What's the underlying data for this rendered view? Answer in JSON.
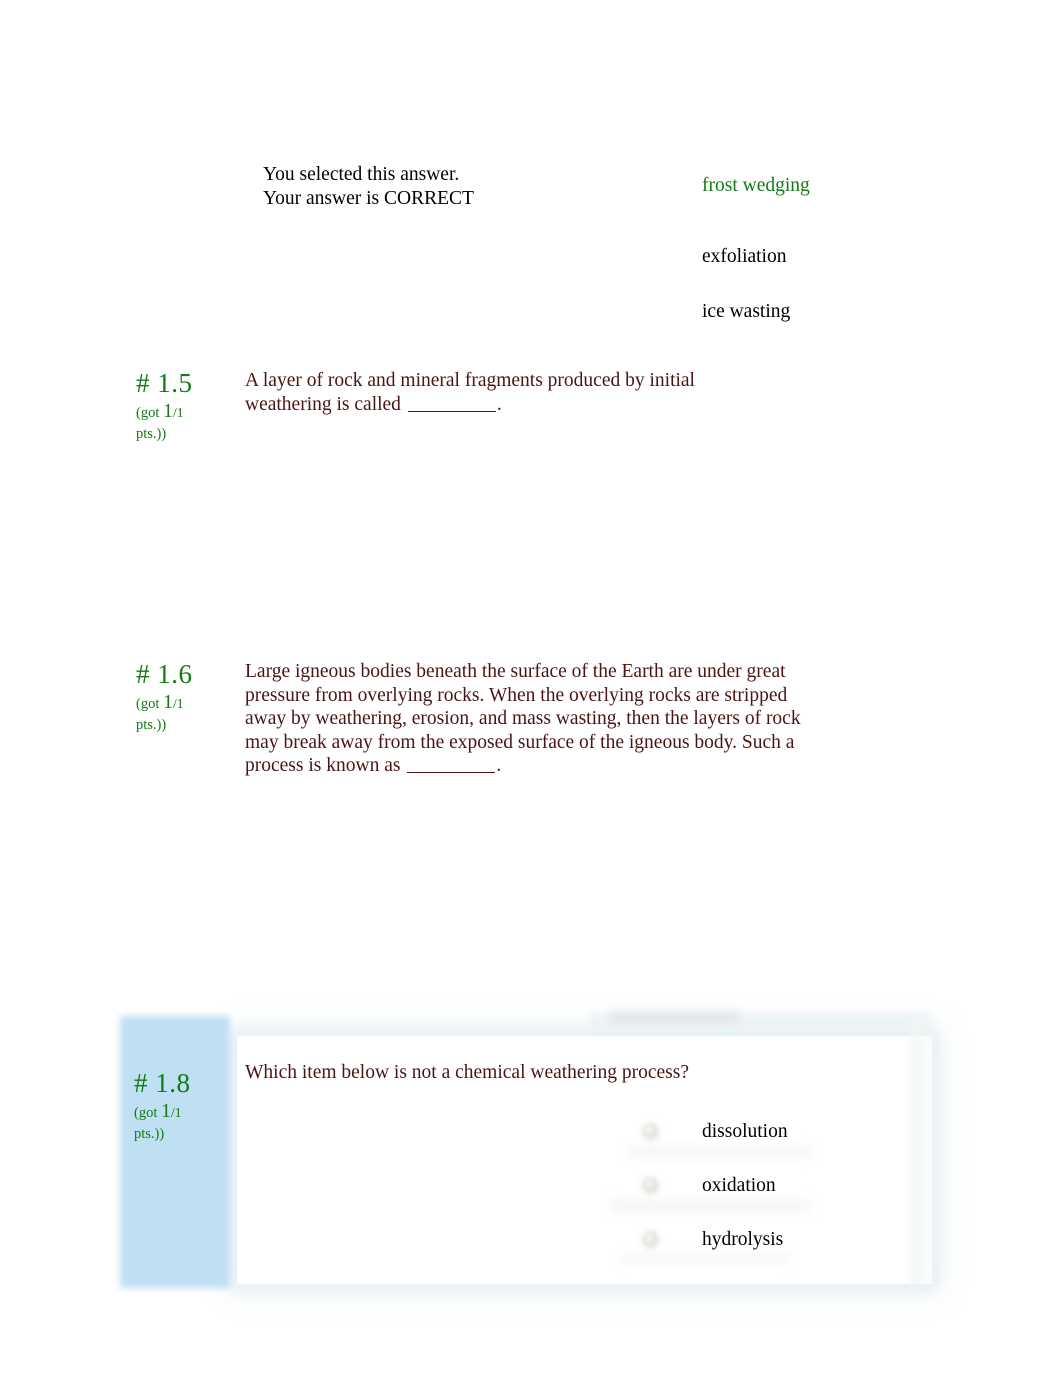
{
  "page": {
    "background_color": "#ffffff",
    "question_text_color": "#4a1414",
    "score_color": "#137a13",
    "selected_answer_color": "#137a13",
    "highlight_panel_color": "#bfdff3"
  },
  "previous_question_feedback": {
    "line1": "You selected this answer.",
    "line2": "Your answer is CORRECT",
    "options": [
      {
        "label": "frost wedging",
        "selected": true
      },
      {
        "label": "exfoliation",
        "selected": false
      },
      {
        "label": "ice wasting",
        "selected": false
      }
    ]
  },
  "questions": [
    {
      "number": "# 1.5",
      "points_prefix": "(got",
      "points_earned": "1",
      "points_possible": "/1",
      "points_suffix": "pts.))",
      "text_before_blank": "A layer of rock and mineral fragments produced by initial weathering is called ",
      "text_after_blank": ".",
      "options": []
    },
    {
      "number": "# 1.6",
      "points_prefix": "(got",
      "points_earned": "1",
      "points_possible": "/1",
      "points_suffix": "pts.))",
      "text_before_blank": "Large igneous bodies beneath the surface of the Earth are under great pressure from overlying rocks. When the overlying rocks are stripped away by weathering, erosion, and mass wasting, then the layers of rock may break away from the exposed surface of the igneous body. Such a process is known as ",
      "text_after_blank": ".",
      "options": []
    },
    {
      "number": "# 1.8",
      "points_prefix": "(got",
      "points_earned": "1",
      "points_possible": "/1",
      "points_suffix": "pts.))",
      "text_before_blank": "Which item below is not a chemical weathering process?",
      "text_after_blank": "",
      "options": [
        {
          "label": "dissolution",
          "selected": false
        },
        {
          "label": "oxidation",
          "selected": false
        },
        {
          "label": "hydrolysis",
          "selected": false
        }
      ]
    }
  ]
}
